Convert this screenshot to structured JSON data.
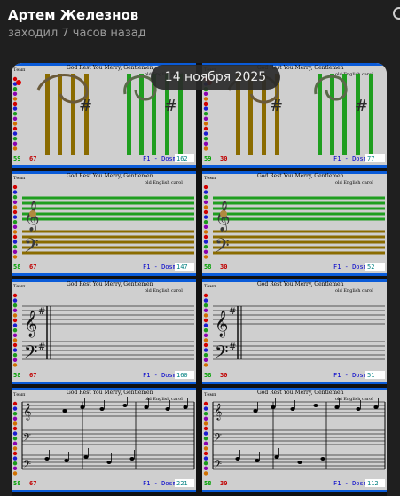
{
  "header": {
    "name": "Артем Железнов",
    "status": "заходил 7 часов назад"
  },
  "date_badge": "14 ноября 2025",
  "colors": {
    "background": "#1f1f1f",
    "cell_background": "#cfcfcf",
    "window_border": "#0a5bd8",
    "staff_brown": "#8a6b00",
    "staff_green": "#1f9e1f",
    "status_green": "#00a000",
    "status_red": "#c00000",
    "status_blue": "#0000cc",
    "status_cyan": "#008080"
  },
  "screens": [
    {
      "title": "God Rest You Merry, Gentlemen",
      "subtitle": "old English carol",
      "tempo": "Темп",
      "left_num": "59",
      "red_num": "67",
      "mode": "F1 - Dosmp",
      "value": "162",
      "style": "bars"
    },
    {
      "title": "God Rest You Merry, Gentlemen",
      "subtitle": "old English carol",
      "tempo": "Темп",
      "left_num": "59",
      "red_num": "30",
      "mode": "F1 - Dosmp",
      "value": "77",
      "style": "bars"
    },
    {
      "title": "God Rest You Merry, Gentlemen",
      "subtitle": "old English carol",
      "tempo": "Темп",
      "left_num": "58",
      "red_num": "67",
      "mode": "F1 - Dosmp",
      "value": "147",
      "style": "wide"
    },
    {
      "title": "God Rest You Merry, Gentlemen",
      "subtitle": "old English carol",
      "tempo": "Темп",
      "left_num": "58",
      "red_num": "30",
      "mode": "F1 - Dosmp",
      "value": "52",
      "style": "wide"
    },
    {
      "title": "God Rest You Merry, Gentlemen",
      "subtitle": "old English carol",
      "tempo": "Темп",
      "left_num": "58",
      "red_num": "67",
      "mode": "F1 - Dosmp",
      "value": "160",
      "style": "plain"
    },
    {
      "title": "God Rest You Merry, Gentlemen",
      "subtitle": "old English carol",
      "tempo": "Темп",
      "left_num": "58",
      "red_num": "30",
      "mode": "F1 - Dosmp",
      "value": "51",
      "style": "plain"
    },
    {
      "title": "God Rest You Merry, Gentlemen",
      "subtitle": "old English carol",
      "tempo": "Темп",
      "left_num": "58",
      "red_num": "67",
      "mode": "F1 - Dosmp",
      "value": "221",
      "style": "notes"
    },
    {
      "title": "God Rest You Merry, Gentlemen",
      "subtitle": "old English carol",
      "tempo": "Темп",
      "left_num": "58",
      "red_num": "30",
      "mode": "F1 - Dosmp",
      "value": "112",
      "style": "notes"
    }
  ]
}
